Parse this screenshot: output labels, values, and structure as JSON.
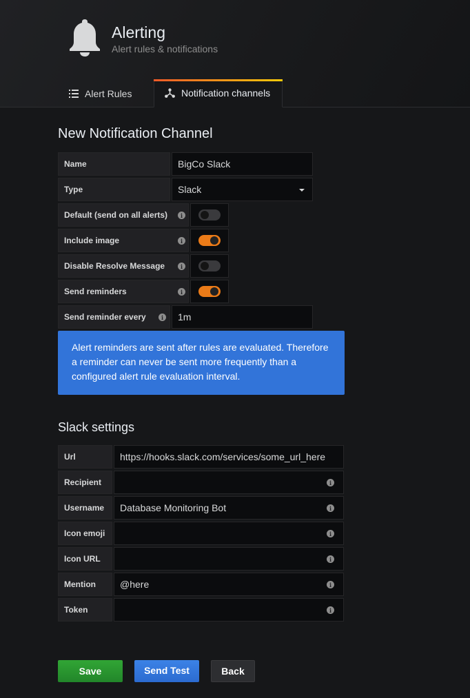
{
  "header": {
    "title": "Alerting",
    "subtitle": "Alert rules & notifications",
    "icon": "bell-icon"
  },
  "tabs": [
    {
      "label": "Alert Rules",
      "icon": "list-icon",
      "active": false
    },
    {
      "label": "Notification channels",
      "icon": "share-nodes-icon",
      "active": true
    }
  ],
  "form": {
    "title": "New Notification Channel",
    "name_label": "Name",
    "name_value": "BigCo Slack",
    "type_label": "Type",
    "type_value": "Slack",
    "default_label": "Default (send on all alerts)",
    "default_on": false,
    "include_image_label": "Include image",
    "include_image_on": true,
    "disable_resolve_label": "Disable Resolve Message",
    "disable_resolve_on": false,
    "send_reminders_label": "Send reminders",
    "send_reminders_on": true,
    "reminder_every_label": "Send reminder every",
    "reminder_every_value": "1m",
    "info_text": "Alert reminders are sent after rules are evaluated. Therefore a reminder can never be sent more frequently than a configured alert rule evaluation interval."
  },
  "slack": {
    "title": "Slack settings",
    "url_label": "Url",
    "url_value": "https://hooks.slack.com/services/some_url_here",
    "recipient_label": "Recipient",
    "recipient_value": "",
    "username_label": "Username",
    "username_value": "Database Monitoring Bot",
    "icon_emoji_label": "Icon emoji",
    "icon_emoji_value": "",
    "icon_url_label": "Icon URL",
    "icon_url_value": "",
    "mention_label": "Mention",
    "mention_value": "@here",
    "token_label": "Token",
    "token_value": ""
  },
  "buttons": {
    "save": "Save",
    "send_test": "Send Test",
    "back": "Back"
  },
  "colors": {
    "toggle_on": "#eb7b18",
    "info_bg": "#3274d9",
    "save_bg": "#299c46",
    "test_bg": "#3274d9"
  }
}
